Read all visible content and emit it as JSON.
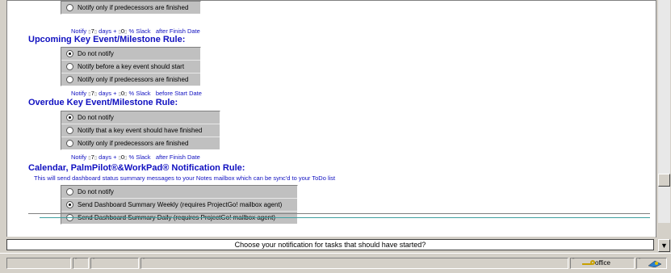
{
  "sections": [
    {
      "heading": "",
      "options": [
        {
          "label": "Notify only if predecessors are finished",
          "selected": false
        }
      ],
      "notify": {
        "prefix": "Notify",
        "days": "7",
        "days_label": "days +",
        "slack": "0",
        "slack_label": "% Slack",
        "suffix": "after Finish Date"
      }
    },
    {
      "heading": "Upcoming Key Event/Milestone Rule:",
      "options": [
        {
          "label": "Do not notify",
          "selected": true
        },
        {
          "label": "Notify before a key event should start",
          "selected": false
        },
        {
          "label": "Notify only if predecessors are finished",
          "selected": false
        }
      ],
      "notify": {
        "prefix": "Notify",
        "days": "7",
        "days_label": "days +",
        "slack": "0",
        "slack_label": "% Slack",
        "suffix": "before Start Date"
      }
    },
    {
      "heading": "Overdue Key Event/Milestone Rule:",
      "options": [
        {
          "label": "Do not notify",
          "selected": true
        },
        {
          "label": "Notify that a key event should have finished",
          "selected": false
        },
        {
          "label": "Notify only if predecessors are finished",
          "selected": false
        }
      ],
      "notify": {
        "prefix": "Notify",
        "days": "7",
        "days_label": "days +",
        "slack": "0",
        "slack_label": "% Slack",
        "suffix": "after Finish Date"
      }
    },
    {
      "heading": "Calendar, PalmPilot®&WorkPad® Notification Rule:",
      "description": "This will send dashboard status summary messages to your Notes mailbox which can be sync'd to your ToDo list",
      "options": [
        {
          "label": "Do not notify",
          "selected": false
        },
        {
          "label": "Send Dashboard Summary Weekly (requires ProjectGo! mailbox agent)",
          "selected": true
        },
        {
          "label": "Send Dashboard Summary Daily (requires ProjectGo! mailbox agent)",
          "selected": false
        }
      ]
    }
  ],
  "status_message": "Choose your notification for tasks that should have started?",
  "bottom_bar": {
    "location": "office",
    "icons": [
      "key-icon",
      "network-icon"
    ]
  },
  "colors": {
    "heading": "#1010c0",
    "group_bg": "#c0c0c0",
    "chrome": "#d4d0c8"
  }
}
